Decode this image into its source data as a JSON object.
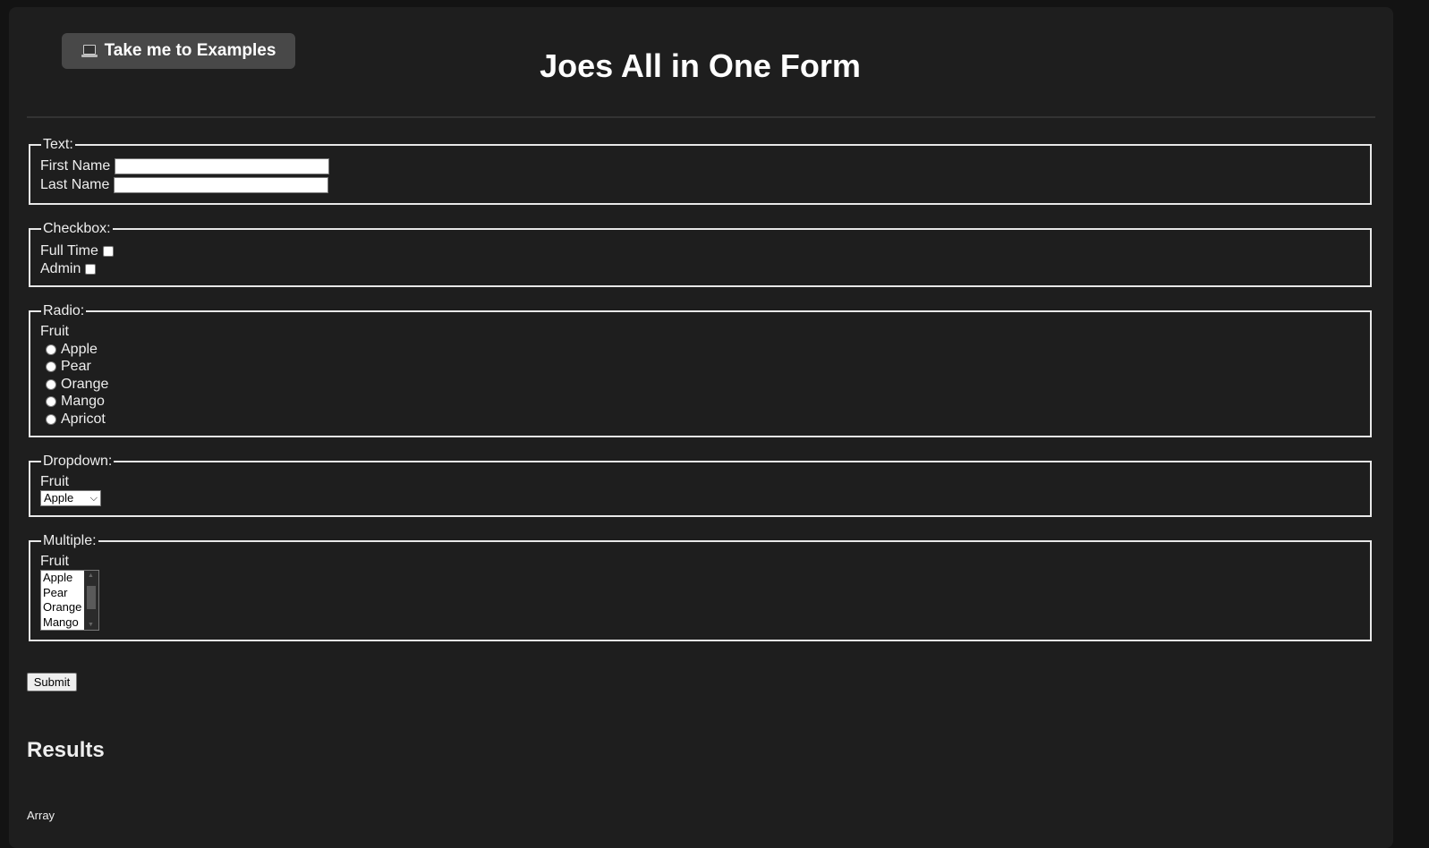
{
  "header": {
    "examples_button": "Take me to Examples",
    "examples_icon": "laptop-icon",
    "title": "Joes All in One Form"
  },
  "text_section": {
    "legend": "Text:",
    "first_name_label": "First Name",
    "first_name_value": "",
    "last_name_label": "Last Name",
    "last_name_value": ""
  },
  "checkbox_section": {
    "legend": "Checkbox:",
    "items": [
      {
        "label": "Full Time",
        "checked": false
      },
      {
        "label": "Admin",
        "checked": false
      }
    ]
  },
  "radio_section": {
    "legend": "Radio:",
    "label": "Fruit",
    "options": [
      "Apple",
      "Pear",
      "Orange",
      "Mango",
      "Apricot"
    ]
  },
  "dropdown_section": {
    "legend": "Dropdown:",
    "label": "Fruit",
    "selected": "Apple"
  },
  "multiple_section": {
    "legend": "Multiple:",
    "label": "Fruit",
    "visible_options": [
      "Apple",
      "Pear",
      "Orange",
      "Mango"
    ]
  },
  "submit_label": "Submit",
  "results": {
    "heading": "Results",
    "output": "Array"
  }
}
